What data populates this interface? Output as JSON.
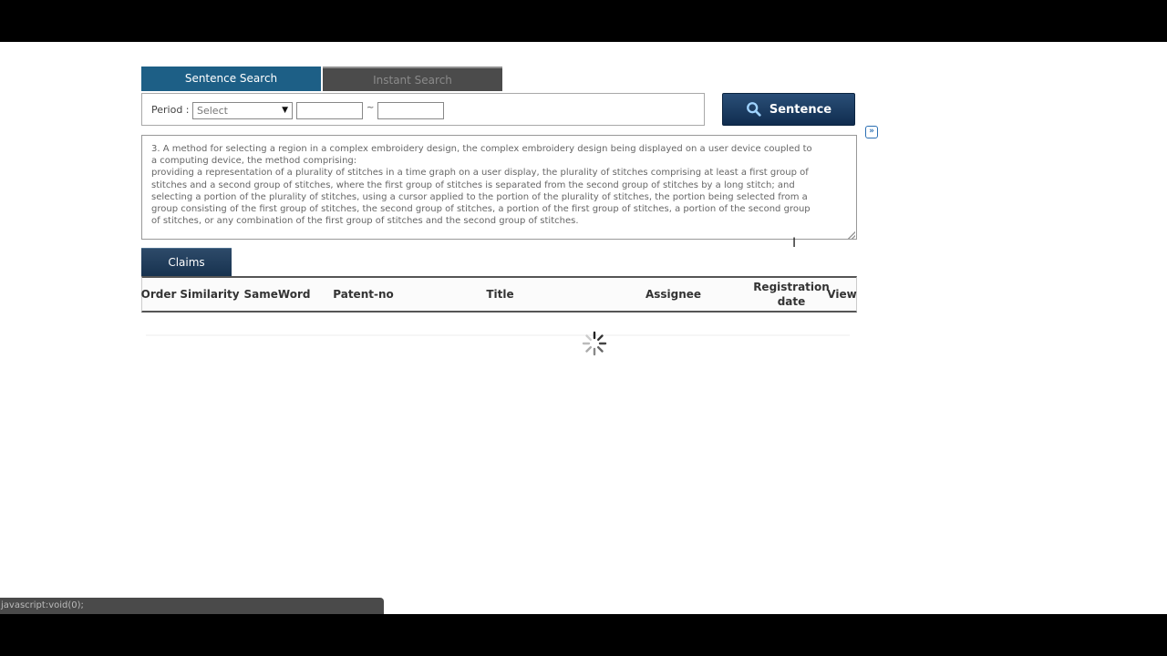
{
  "tabs": {
    "sentence_search": "Sentence Search",
    "instant_search": "Instant Search"
  },
  "period": {
    "label": "Period :",
    "select_value": "Select",
    "date_separator": "~",
    "from_value": "",
    "to_value": ""
  },
  "sentence_button": {
    "label": "Sentence"
  },
  "query_text": "3. A method for selecting a region in a complex embroidery design, the complex embroidery design being displayed on a user device coupled to\na computing device, the method comprising:\nproviding a representation of a plurality of stitches in a time graph on a user display, the plurality of stitches comprising at least a first group of\nstitches and a second group of stitches, where the first group of stitches is separated from the second group of stitches by a long stitch; and\nselecting a portion of the plurality of stitches, using a cursor applied to the portion of the plurality of stitches, the portion being selected from a\ngroup consisting of the first group of stitches, the second group of stitches, a portion of the first group of stitches, a portion of the second group\nof stitches, or any combination of the first group of stitches and the second group of stitches.",
  "claims_tab": {
    "label": "Claims"
  },
  "table": {
    "columns": [
      "Order",
      "Similarity",
      "SameWord",
      "Patent-no",
      "Title",
      "Assignee",
      "Registration date",
      "View"
    ]
  },
  "status_bar": {
    "text": "javascript:void(0);"
  },
  "colors": {
    "sentence_tab": "#1d5f86",
    "instant_tab": "#4b4b4b",
    "button_dark": "#102d4f"
  }
}
